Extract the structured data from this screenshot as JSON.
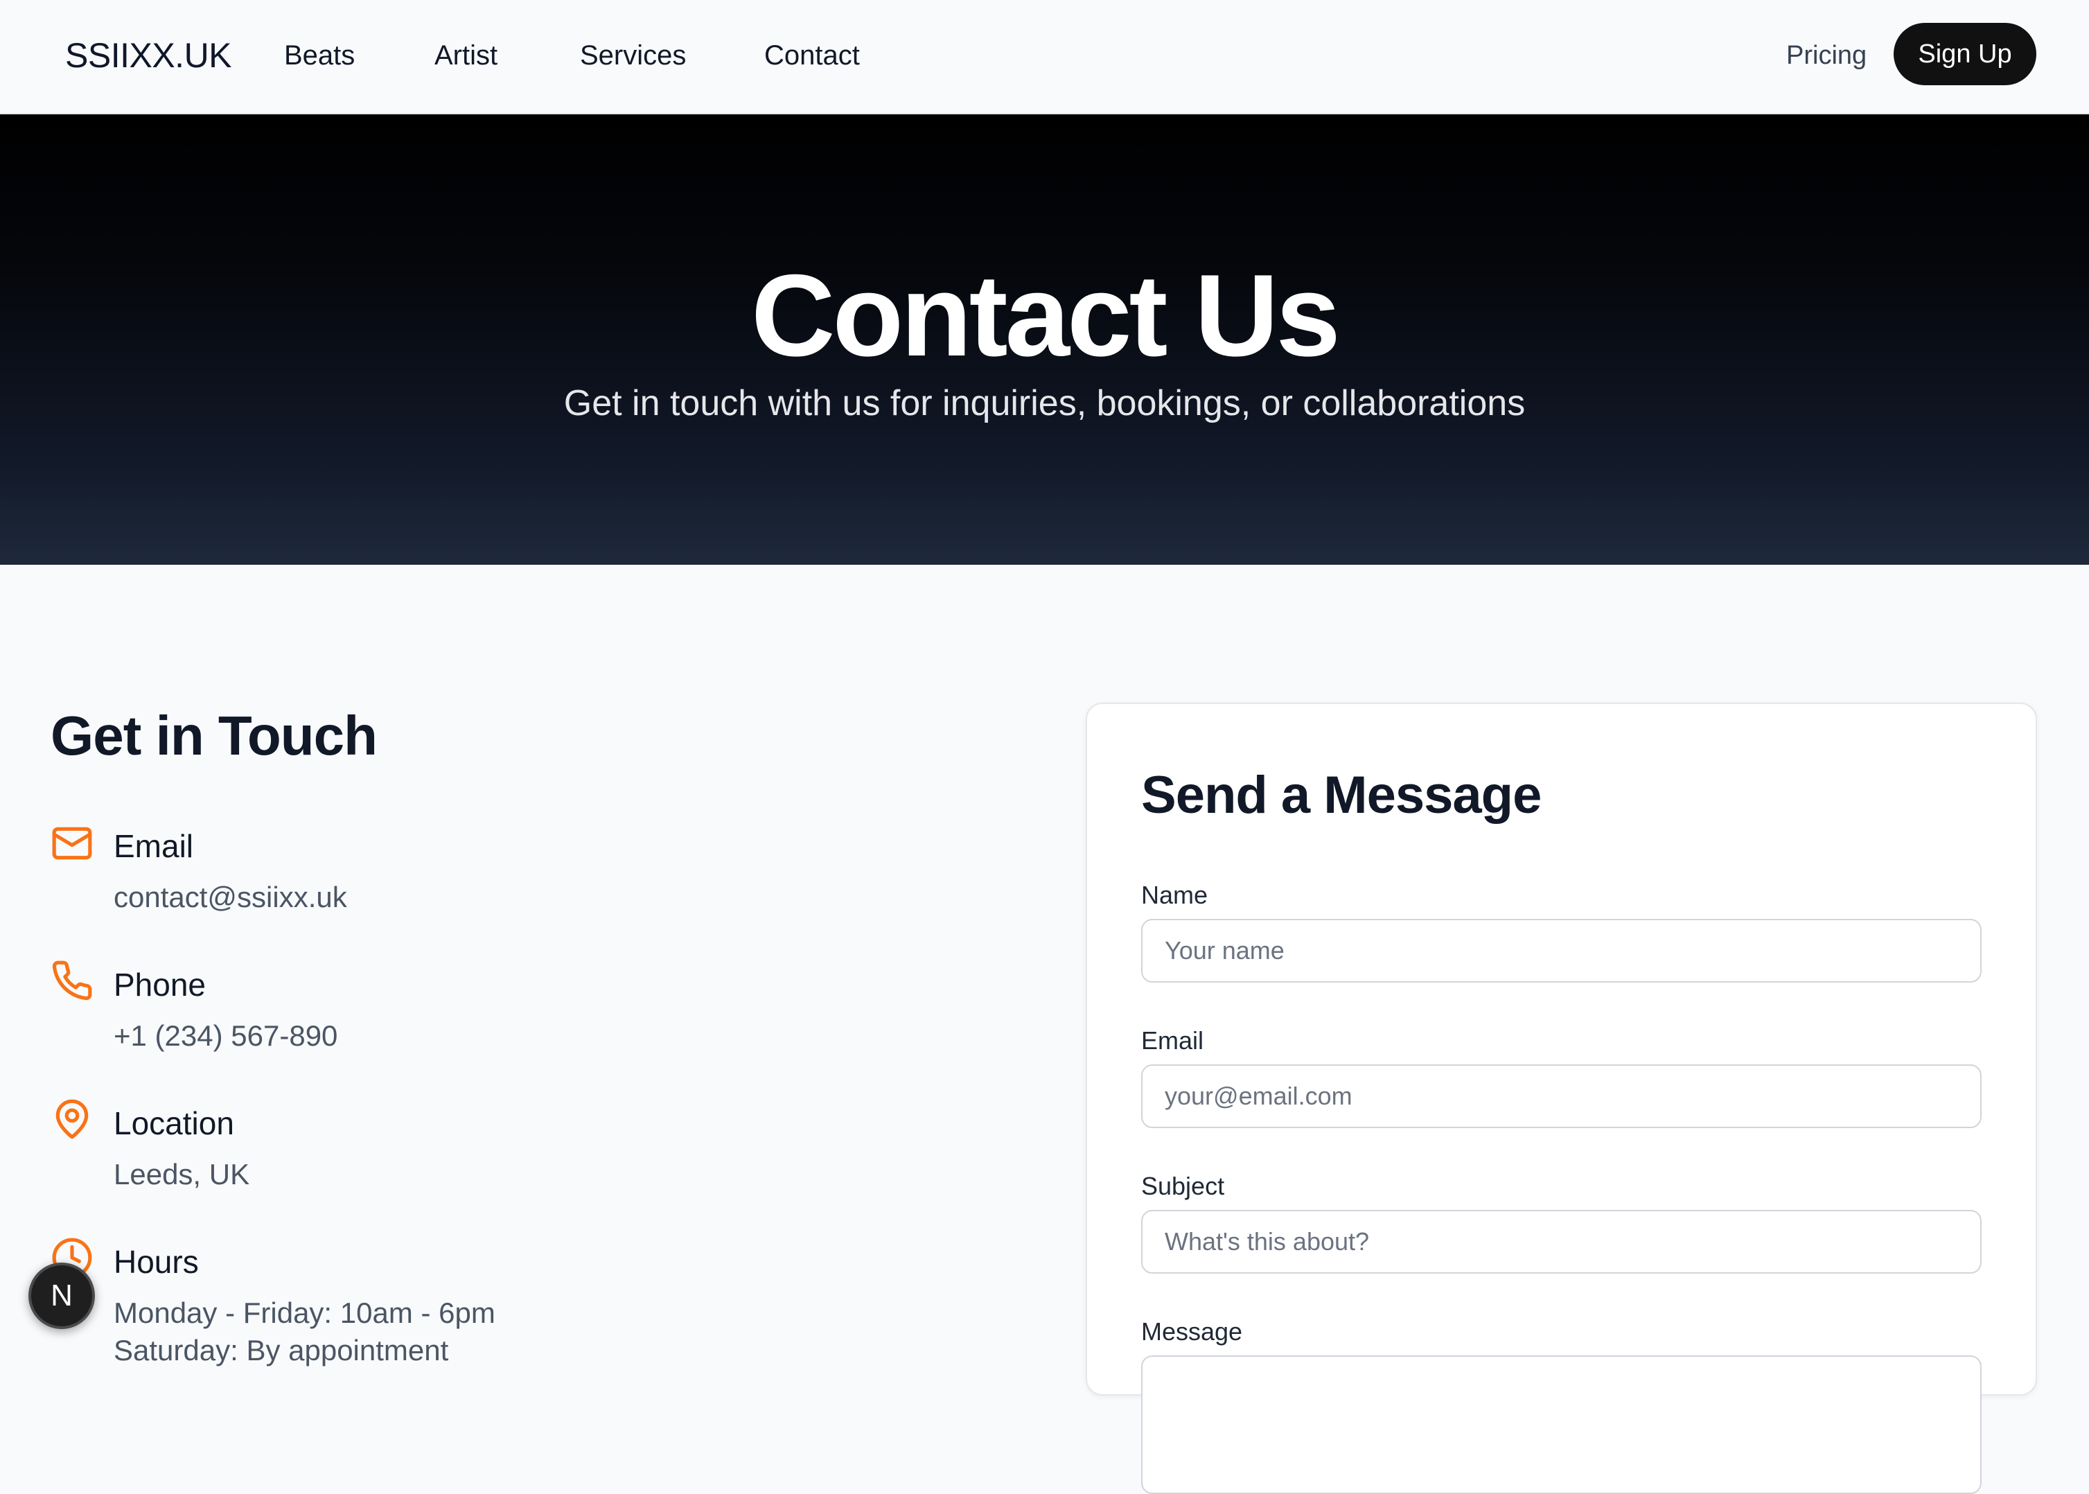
{
  "nav": {
    "brand": "SSIIXX.UK",
    "links": [
      "Beats",
      "Artist",
      "Services",
      "Contact"
    ],
    "pricing": "Pricing",
    "signup": "Sign Up"
  },
  "hero": {
    "title": "Contact Us",
    "subtitle": "Get in touch with us for inquiries, bookings, or collaborations"
  },
  "info": {
    "title": "Get in Touch",
    "accent_color": "#f97316",
    "items": [
      {
        "icon": "mail-icon",
        "label": "Email",
        "value": "contact@ssiixx.uk"
      },
      {
        "icon": "phone-icon",
        "label": "Phone",
        "value": "+1 (234) 567-890"
      },
      {
        "icon": "map-pin-icon",
        "label": "Location",
        "value": "Leeds, UK"
      },
      {
        "icon": "clock-icon",
        "label": "Hours",
        "values": [
          "Monday - Friday: 10am - 6pm",
          "Saturday: By appointment"
        ]
      }
    ]
  },
  "form": {
    "title": "Send a Message",
    "fields": [
      {
        "label": "Name",
        "placeholder": "Your name",
        "value": ""
      },
      {
        "label": "Email",
        "placeholder": "your@email.com",
        "value": ""
      },
      {
        "label": "Subject",
        "placeholder": "What's this about?",
        "value": ""
      },
      {
        "label": "Message",
        "placeholder": "",
        "value": ""
      }
    ]
  },
  "badge": {
    "letter": "N"
  }
}
